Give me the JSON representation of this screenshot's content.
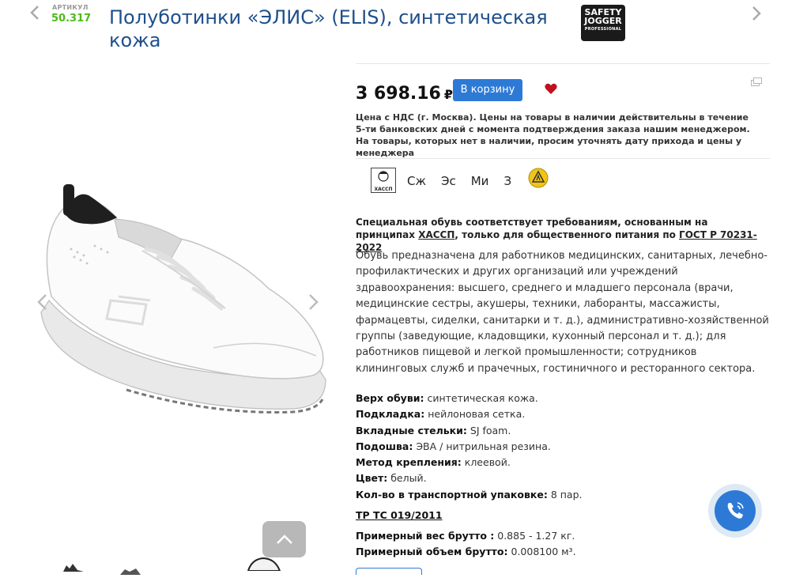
{
  "nav": {
    "prev_icon": "chevron-left-icon",
    "next_icon": "chevron-right-icon"
  },
  "sku": {
    "label": "АРТИКУЛ",
    "value": "50.317"
  },
  "title": "Полуботинки «ЭЛИС» (ELIS), синтетическая кожа",
  "brand": {
    "line1": "SAFETY",
    "line2": "JOGGER",
    "line3": "PROFESSIONAL"
  },
  "price": {
    "value": "3 698.16",
    "currency": "₽"
  },
  "cart_button": "В корзину",
  "price_note": "Цена с НДС (г. Москва). Цены на товары в наличии действительны в течение 5-ти банковских дней с момента подтверждения заказа нашим менеджером. На товары, которых нет в наличии, просим уточнять дату прихода и цены у менеджера",
  "badges": {
    "haccp_label": "ХАССП",
    "tags": [
      "Сж",
      "Эс",
      "Ми",
      "З"
    ]
  },
  "haccp_note": {
    "part1": "Специальная обувь соответствует требованиям, основанным на принципах ",
    "link1": "ХАССП",
    "part2": ", только для общественного питания по ",
    "link2": "ГОСТ Р 70231-2022"
  },
  "description": "Обувь предназначена для работников медицинских, санитарных, лечебно-профилактических и других организаций или учреждений здравоохранения: высшего, среднего и младшего персонала (врачи, медицинские сестры, акушеры, техники, лаборанты, массажисты, фармацевты, сиделки, санитарки и т. д.), административно-хозяйственной группы (заведующие, кладовщики, кухонный персонал и т. д.); для работников пищевой и легкой промышленности; сотрудников клининговых служб и прачечных, гостиничного и ресторанного сектора.",
  "specs": [
    {
      "label": "Верх обуви:",
      "value": " синтетическая кожа."
    },
    {
      "label": "Подкладка:",
      "value": " нейлоновая сетка."
    },
    {
      "label": "Вкладные стельки:",
      "value": " SJ foam."
    },
    {
      "label": "Подошва:",
      "value": " ЭВА / нитрильная резина."
    },
    {
      "label": "Метод крепления:",
      "value": " клеевой."
    },
    {
      "label": "Цвет:",
      "value": " белый."
    },
    {
      "label": "Кол-во в транспортной упаковке:",
      "value": " 8 пар."
    }
  ],
  "tr_ts": "ТР ТС 019/2011",
  "weight": {
    "label": "Примерный вес брутто :",
    "value": " 0.885 - 1.27 кг."
  },
  "volume": {
    "label": "Примерный объем брутто:",
    "value": " 0.008100 м³."
  },
  "colors": {
    "title": "#1e4f8c",
    "sku": "#4cbb17",
    "button": "#2d7ad6",
    "heart": "#c0111f"
  }
}
